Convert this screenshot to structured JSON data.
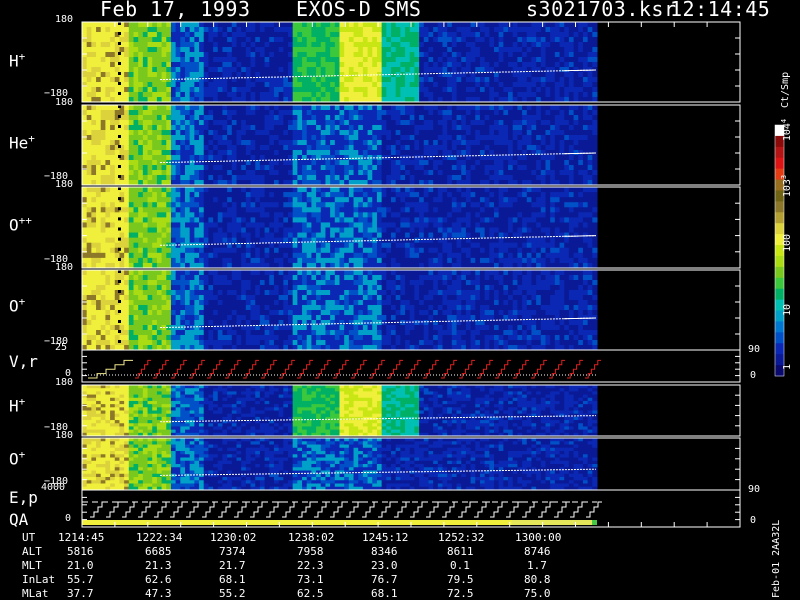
{
  "header": {
    "date": "Feb 17, 1993",
    "instrument": "EXOS-D SMS",
    "file": "s3021703.ksr",
    "time": "12:14:45"
  },
  "colorbar": {
    "unit": "Ct/Smp",
    "ticks": [
      "1",
      "10",
      "100",
      "10^3",
      "10^4"
    ],
    "colors": [
      "#0a0a6e",
      "#0a1a96",
      "#0a28b4",
      "#0050c8",
      "#0078d2",
      "#00a0c8",
      "#00c0b4",
      "#00b064",
      "#3cc83c",
      "#78c81e",
      "#aadc14",
      "#c8e614",
      "#f0f03c",
      "#dcd23c",
      "#b4a032",
      "#8c7828",
      "#6e6414",
      "#966e1e",
      "#e63c14",
      "#dc1414",
      "#b41414",
      "#8c0a0a",
      "#ffffff"
    ]
  },
  "panels": [
    {
      "label": "H",
      "sup": "+",
      "ymax": "180",
      "ymin": "−180"
    },
    {
      "label": "He",
      "sup": "+",
      "ymax": "180",
      "ymin": "−180"
    },
    {
      "label": "O",
      "sup": "++",
      "ymax": "180",
      "ymin": "−180"
    },
    {
      "label": "O",
      "sup": "+",
      "ymax": "180",
      "ymin": "−180"
    },
    {
      "label": "V,r",
      "sup": "",
      "ymax": "25",
      "ymin": "0",
      "right_top": "90",
      "right_bottom": "0"
    },
    {
      "label": "H",
      "sup": "+",
      "ymax": "180",
      "ymin": "−180"
    },
    {
      "label": "O",
      "sup": "+",
      "ymax": "180",
      "ymin": "−180"
    },
    {
      "label": "E,p",
      "sub_label": "QA",
      "ymax": "4000",
      "ymin": "0",
      "right_top": "90",
      "right_bottom": "0"
    }
  ],
  "orbit_table": {
    "row_labels": [
      "UT",
      "ALT",
      "MLT",
      "InLat",
      "MLat"
    ],
    "columns": [
      [
        "1214:45",
        "5816",
        "21.0",
        "55.7",
        "37.7"
      ],
      [
        "1222:34",
        "6685",
        "21.3",
        "62.6",
        "47.3"
      ],
      [
        "1230:02",
        "7374",
        "21.7",
        "68.1",
        "55.2"
      ],
      [
        "1238:02",
        "7958",
        "22.3",
        "73.1",
        "62.5"
      ],
      [
        "1245:12",
        "8346",
        "23.0",
        "76.7",
        "68.1"
      ],
      [
        "1252:32",
        "8611",
        "0.1",
        "79.5",
        "72.5"
      ],
      [
        "1300:00",
        "8746",
        "1.7",
        "80.8",
        "75.0"
      ]
    ]
  },
  "footer_note": "Feb-01 2AA32L",
  "chart_data": {
    "type": "heatmap",
    "title": "Feb 17, 1993   EXOS-D SMS",
    "x_ticks": [
      "1214:45",
      "1222:34",
      "1230:02",
      "1238:02",
      "1245:12",
      "1252:32",
      "1300:00"
    ],
    "y_range_pitch": [
      -180,
      180
    ],
    "colorbar_range": [
      1,
      10000
    ],
    "colorbar_scale": "log",
    "series": [
      {
        "name": "H+"
      },
      {
        "name": "He+"
      },
      {
        "name": "O++"
      },
      {
        "name": "O+"
      },
      {
        "name": "V,r",
        "ylim": [
          0,
          25
        ]
      },
      {
        "name": "H+"
      },
      {
        "name": "O+"
      },
      {
        "name": "E,p",
        "ylim": [
          0,
          4000
        ]
      }
    ]
  }
}
